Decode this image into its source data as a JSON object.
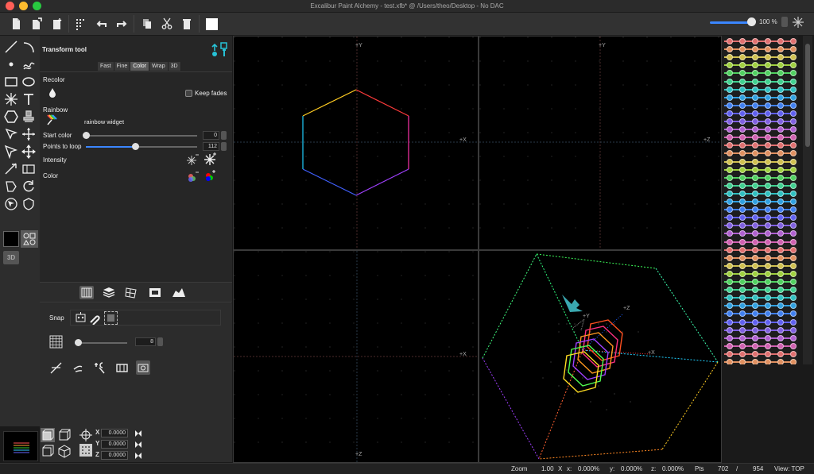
{
  "window": {
    "title": "Excalibur Paint Alchemy - test.xfb* @ /Users/theo/Desktop - No  DAC"
  },
  "toolbar": {
    "zoom_label": "100 %"
  },
  "panel": {
    "title": "Transform tool",
    "tabs": [
      "Fast",
      "Fine",
      "Color",
      "Wrap",
      "3D"
    ],
    "active_tab": "Color",
    "recolor_label": "Recolor",
    "keep_fades_label": "Keep fades",
    "rainbow_label": "Rainbow",
    "rainbow_widget_label": "rainbow widget",
    "start_color_label": "Start color",
    "start_color_value": "0",
    "start_color_fraction": 0.0,
    "points_to_loop_label": "Points to loop",
    "points_to_loop_value": "112",
    "points_to_loop_fraction": 0.44,
    "intensity_label": "Intensity",
    "color_label": "Color"
  },
  "snap": {
    "label": "Snap",
    "grid_value": "8",
    "grid_fraction": 0.06
  },
  "coords": {
    "x_label": "X",
    "x_value": "0.0000",
    "y_label": "Y",
    "y_value": "0.0000",
    "z_label": "Z",
    "z_value": "0.0000"
  },
  "viewports": {
    "front": {
      "up": "+Y",
      "right": "+X"
    },
    "side": {
      "up": "+Y",
      "right": "+Z"
    },
    "top": {
      "right": "+X",
      "down": "+Z"
    },
    "perspective": {
      "y": "+Y",
      "z": "+Z",
      "x": "+X"
    }
  },
  "status": {
    "zoom_label": "Zoom",
    "zoom_value": "1.00",
    "x_label": "X",
    "x_coord_label": "x:",
    "x_coord_value": "0.000%",
    "y_coord_label": "y:",
    "y_coord_value": "0.000%",
    "z_coord_label": "z:",
    "z_coord_value": "0.000%",
    "pts_label": "Pts",
    "pts_current": "702",
    "pts_sep": "/",
    "pts_total": "954",
    "view_label": "View: TOP"
  },
  "colors": {
    "accent": "#3b86ff",
    "teal_icon": "#27c2d6"
  }
}
